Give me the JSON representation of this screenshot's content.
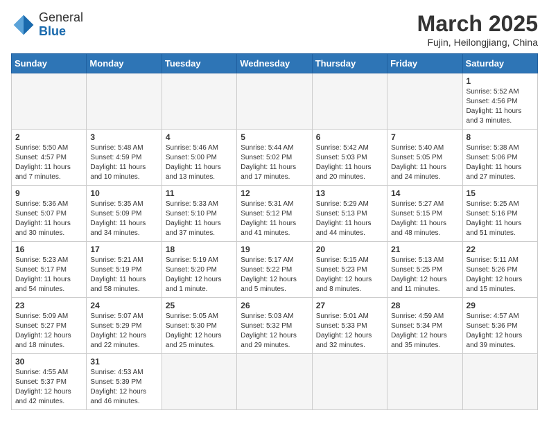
{
  "header": {
    "logo_general": "General",
    "logo_blue": "Blue",
    "month_title": "March 2025",
    "location": "Fujin, Heilongjiang, China"
  },
  "weekdays": [
    "Sunday",
    "Monday",
    "Tuesday",
    "Wednesday",
    "Thursday",
    "Friday",
    "Saturday"
  ],
  "weeks": [
    [
      {
        "day": "",
        "info": ""
      },
      {
        "day": "",
        "info": ""
      },
      {
        "day": "",
        "info": ""
      },
      {
        "day": "",
        "info": ""
      },
      {
        "day": "",
        "info": ""
      },
      {
        "day": "",
        "info": ""
      },
      {
        "day": "1",
        "info": "Sunrise: 5:52 AM\nSunset: 4:56 PM\nDaylight: 11 hours\nand 3 minutes."
      }
    ],
    [
      {
        "day": "2",
        "info": "Sunrise: 5:50 AM\nSunset: 4:57 PM\nDaylight: 11 hours\nand 7 minutes."
      },
      {
        "day": "3",
        "info": "Sunrise: 5:48 AM\nSunset: 4:59 PM\nDaylight: 11 hours\nand 10 minutes."
      },
      {
        "day": "4",
        "info": "Sunrise: 5:46 AM\nSunset: 5:00 PM\nDaylight: 11 hours\nand 13 minutes."
      },
      {
        "day": "5",
        "info": "Sunrise: 5:44 AM\nSunset: 5:02 PM\nDaylight: 11 hours\nand 17 minutes."
      },
      {
        "day": "6",
        "info": "Sunrise: 5:42 AM\nSunset: 5:03 PM\nDaylight: 11 hours\nand 20 minutes."
      },
      {
        "day": "7",
        "info": "Sunrise: 5:40 AM\nSunset: 5:05 PM\nDaylight: 11 hours\nand 24 minutes."
      },
      {
        "day": "8",
        "info": "Sunrise: 5:38 AM\nSunset: 5:06 PM\nDaylight: 11 hours\nand 27 minutes."
      }
    ],
    [
      {
        "day": "9",
        "info": "Sunrise: 5:36 AM\nSunset: 5:07 PM\nDaylight: 11 hours\nand 30 minutes."
      },
      {
        "day": "10",
        "info": "Sunrise: 5:35 AM\nSunset: 5:09 PM\nDaylight: 11 hours\nand 34 minutes."
      },
      {
        "day": "11",
        "info": "Sunrise: 5:33 AM\nSunset: 5:10 PM\nDaylight: 11 hours\nand 37 minutes."
      },
      {
        "day": "12",
        "info": "Sunrise: 5:31 AM\nSunset: 5:12 PM\nDaylight: 11 hours\nand 41 minutes."
      },
      {
        "day": "13",
        "info": "Sunrise: 5:29 AM\nSunset: 5:13 PM\nDaylight: 11 hours\nand 44 minutes."
      },
      {
        "day": "14",
        "info": "Sunrise: 5:27 AM\nSunset: 5:15 PM\nDaylight: 11 hours\nand 48 minutes."
      },
      {
        "day": "15",
        "info": "Sunrise: 5:25 AM\nSunset: 5:16 PM\nDaylight: 11 hours\nand 51 minutes."
      }
    ],
    [
      {
        "day": "16",
        "info": "Sunrise: 5:23 AM\nSunset: 5:17 PM\nDaylight: 11 hours\nand 54 minutes."
      },
      {
        "day": "17",
        "info": "Sunrise: 5:21 AM\nSunset: 5:19 PM\nDaylight: 11 hours\nand 58 minutes."
      },
      {
        "day": "18",
        "info": "Sunrise: 5:19 AM\nSunset: 5:20 PM\nDaylight: 12 hours\nand 1 minute."
      },
      {
        "day": "19",
        "info": "Sunrise: 5:17 AM\nSunset: 5:22 PM\nDaylight: 12 hours\nand 5 minutes."
      },
      {
        "day": "20",
        "info": "Sunrise: 5:15 AM\nSunset: 5:23 PM\nDaylight: 12 hours\nand 8 minutes."
      },
      {
        "day": "21",
        "info": "Sunrise: 5:13 AM\nSunset: 5:25 PM\nDaylight: 12 hours\nand 11 minutes."
      },
      {
        "day": "22",
        "info": "Sunrise: 5:11 AM\nSunset: 5:26 PM\nDaylight: 12 hours\nand 15 minutes."
      }
    ],
    [
      {
        "day": "23",
        "info": "Sunrise: 5:09 AM\nSunset: 5:27 PM\nDaylight: 12 hours\nand 18 minutes."
      },
      {
        "day": "24",
        "info": "Sunrise: 5:07 AM\nSunset: 5:29 PM\nDaylight: 12 hours\nand 22 minutes."
      },
      {
        "day": "25",
        "info": "Sunrise: 5:05 AM\nSunset: 5:30 PM\nDaylight: 12 hours\nand 25 minutes."
      },
      {
        "day": "26",
        "info": "Sunrise: 5:03 AM\nSunset: 5:32 PM\nDaylight: 12 hours\nand 29 minutes."
      },
      {
        "day": "27",
        "info": "Sunrise: 5:01 AM\nSunset: 5:33 PM\nDaylight: 12 hours\nand 32 minutes."
      },
      {
        "day": "28",
        "info": "Sunrise: 4:59 AM\nSunset: 5:34 PM\nDaylight: 12 hours\nand 35 minutes."
      },
      {
        "day": "29",
        "info": "Sunrise: 4:57 AM\nSunset: 5:36 PM\nDaylight: 12 hours\nand 39 minutes."
      }
    ],
    [
      {
        "day": "30",
        "info": "Sunrise: 4:55 AM\nSunset: 5:37 PM\nDaylight: 12 hours\nand 42 minutes."
      },
      {
        "day": "31",
        "info": "Sunrise: 4:53 AM\nSunset: 5:39 PM\nDaylight: 12 hours\nand 46 minutes."
      },
      {
        "day": "",
        "info": ""
      },
      {
        "day": "",
        "info": ""
      },
      {
        "day": "",
        "info": ""
      },
      {
        "day": "",
        "info": ""
      },
      {
        "day": "",
        "info": ""
      }
    ]
  ]
}
